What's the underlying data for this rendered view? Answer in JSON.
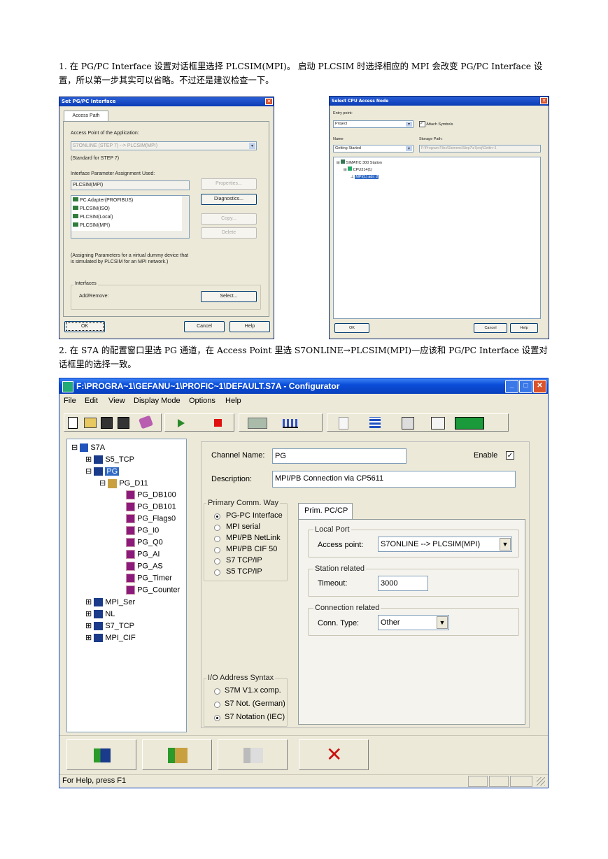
{
  "doc": {
    "para1": "1. 在 PG/PC Interface 设置对话框里选择 PLCSIM(MPI)。 启动 PLCSIM 时选择相应的 MPI 会改变 PG/PC Interface 设置，所以第一步其实可以省略。不过还是建议检查一下。",
    "para2": "2. 在 S7A 的配置窗口里选 PG 通道，在 Access Point 里选 S7ONLINE→PLCSIM(MPI)—应该和 PG/PC Interface 设置对话框里的选择一致。"
  },
  "pgpc": {
    "title": "Set PG/PC Interface",
    "tab": "Access Path",
    "access_point_label": "Access Point of the Application:",
    "access_point_value": "S7ONLINE    (STEP 7)      --> PLCSIM(MPI)",
    "standard_note": "(Standard for STEP 7)",
    "param_label": "Interface Parameter Assignment Used:",
    "param_value": "PLCSIM(MPI)",
    "list": [
      "PC Adapter(PROFIBUS)",
      "PLCSIM(ISO)",
      "PLCSIM(Local)",
      "PLCSIM(MPI)"
    ],
    "properties": "Properties...",
    "diagnostics": "Diagnostics...",
    "copy": "Copy...",
    "delete": "Delete",
    "description": "(Assigning Parameters for a virtual dummy device that is simulated by PLCSIM for an MPI network.)",
    "interfaces_group": "Interfaces",
    "add_remove": "Add/Remove:",
    "select": "Select...",
    "ok": "OK",
    "cancel": "Cancel",
    "help": "Help"
  },
  "cpu": {
    "title": "Select CPU Access Node",
    "entry_label": "Entry point:",
    "entry_value": "Project",
    "attach_symbols": "Attach Symbols",
    "name_label": "Name",
    "name_value": "Getting Started",
    "storage_label": "Storage Path:",
    "storage_value": "F:\\Program Files\\Siemens\\Step7\\s7proj\\Gettin~1",
    "tree": [
      "SIMATIC 300 Station",
      "CPU314(1)",
      "MPI(1) adr: 2"
    ],
    "ok": "OK",
    "cancel": "Cancel",
    "help": "Help"
  },
  "cfg": {
    "title": "F:\\PROGRA~1\\GEFANU~1\\PROFIC~1\\DEFAULT.S7A - Configurator",
    "menu": [
      "File",
      "Edit",
      "View",
      "Display Mode",
      "Options",
      "Help"
    ],
    "tree": {
      "root": "S7A",
      "s5tcp": "S5_TCP",
      "pg": "PG",
      "pgd11": "PG_D11",
      "leaves": [
        "PG_DB100",
        "PG_DB101",
        "PG_Flags0",
        "PG_I0",
        "PG_Q0",
        "PG_AI",
        "PG_AS",
        "PG_Timer",
        "PG_Counter"
      ],
      "others": [
        "MPI_Ser",
        "NL",
        "S7_TCP",
        "MPI_CIF"
      ]
    },
    "channel_name_label": "Channel Name:",
    "channel_name": "PG",
    "enable_label": "Enable",
    "description_label": "Description:",
    "description": "MPI/PB Connection via CP5611",
    "primary_group": "Primary Comm. Way",
    "primary_options": [
      "PG-PC Interface",
      "MPI serial",
      "MPI/PB NetLink",
      "MPI/PB CIF 50",
      "S7 TCP/IP",
      "S5 TCP/IP"
    ],
    "tab": "Prim. PC/CP",
    "local_port_group": "Local Port",
    "access_point_label": "Access point:",
    "access_point_value": "S7ONLINE --> PLCSIM(MPI)",
    "station_group": "Station related",
    "timeout_label": "Timeout:",
    "timeout_value": "3000",
    "conn_group": "Connection related",
    "conn_type_label": "Conn. Type:",
    "conn_type_value": "Other",
    "io_group": "I/O Address Syntax",
    "io_options": [
      "S7M V1.x comp.",
      "S7 Not. (German)",
      "S7 Notation (IEC)"
    ],
    "status": "For Help, press F1"
  }
}
